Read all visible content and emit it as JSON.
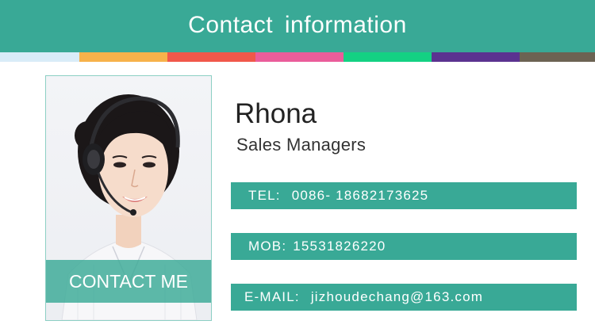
{
  "header": {
    "title": "Contact  information"
  },
  "stripe_colors": [
    "#d9ecf8",
    "#f7b24a",
    "#f0584a",
    "#ea5d9a",
    "#14d183",
    "#5b3390",
    "#6c6353"
  ],
  "photo": {
    "cta_label": "CONTACT ME"
  },
  "profile": {
    "name": "Rhona",
    "role": "Sales Managers"
  },
  "contacts": {
    "tel": {
      "label": "TEL:",
      "value": "0086- 18682173625"
    },
    "mob": {
      "label": "MOB:",
      "value": "15531826220"
    },
    "email": {
      "label": "E-MAIL:",
      "value": "jizhoudechang@163.com"
    }
  },
  "colors": {
    "accent": "#39a996",
    "photo_border": "#8ccfc4"
  }
}
